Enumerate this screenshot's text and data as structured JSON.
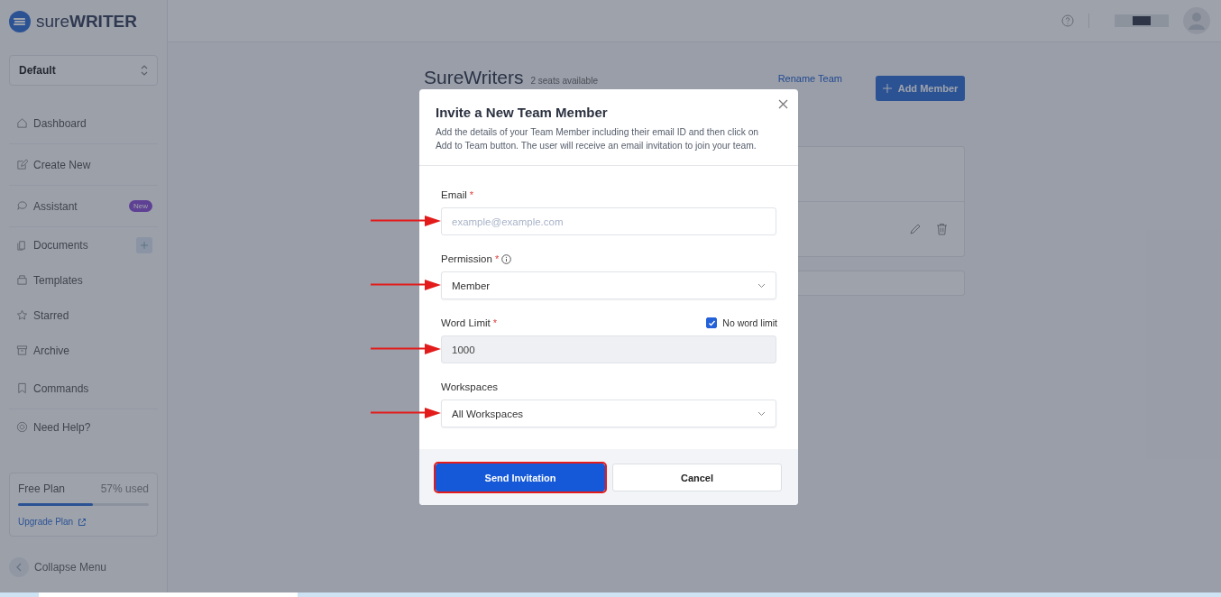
{
  "brand": {
    "name_light": "sure",
    "name_bold": "WRITER"
  },
  "workspace_select": {
    "value": "Default"
  },
  "sidebar": {
    "items": [
      {
        "label": "Dashboard",
        "divider_after": true
      },
      {
        "label": "Create New",
        "divider_after": true
      },
      {
        "label": "Assistant",
        "badge": "New",
        "divider_after": true
      },
      {
        "label": "Documents",
        "add_button": true,
        "divider_after": false
      },
      {
        "label": "Templates",
        "divider_after": false
      },
      {
        "label": "Starred",
        "divider_after": false
      },
      {
        "label": "Archive",
        "divider_after": false
      },
      {
        "label": "Commands",
        "divider_after": true
      },
      {
        "label": "Need Help?",
        "divider_after": false
      }
    ]
  },
  "plan": {
    "name": "Free Plan",
    "usage": "57% used",
    "level": 0.57,
    "upgrade_link": "Upgrade Plan"
  },
  "collapse": {
    "label": "Collapse Menu"
  },
  "team": {
    "title": "SureWriters",
    "seats": "2 seats available",
    "rename_link": "Rename Team",
    "add_button": "Add Member"
  },
  "modal": {
    "title": "Invite a New Team Member",
    "description": "Add the details of your Team Member including their email ID and then click on Add to Team button. The user will receive an email invitation to join your team.",
    "fields": [
      {
        "kind": "input",
        "label": "Email",
        "required_mark": "*",
        "placeholder": "example@example.com",
        "annotated": true
      },
      {
        "kind": "select",
        "label": "Permission",
        "required_mark": "*",
        "info": true,
        "value": "Member",
        "annotated": true
      },
      {
        "kind": "number",
        "label": "Word Limit",
        "required_mark": "*",
        "value": "1000",
        "checkbox": {
          "label": "No word limit",
          "checked": true
        },
        "annotated": true
      },
      {
        "kind": "select",
        "label": "Workspaces",
        "value": "All Workspaces",
        "annotated": true
      }
    ],
    "buttons": [
      {
        "label": "Send Invitation",
        "kind": "primary",
        "highlighted": true
      },
      {
        "label": "Cancel",
        "kind": "secondary",
        "highlighted": false
      }
    ]
  }
}
